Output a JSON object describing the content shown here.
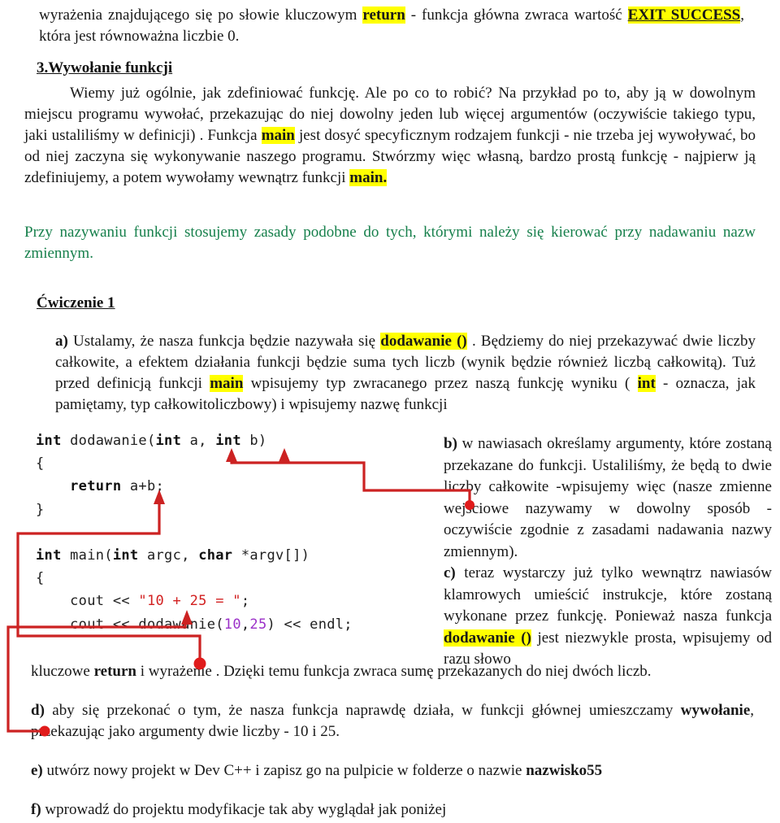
{
  "document": {
    "language": "pl",
    "colors": {
      "highlight": "#ffff00",
      "green_text": "#17804c",
      "annotation_red": "#cc2222",
      "code_string": "#d22020",
      "code_number": "#9b30c8"
    }
  },
  "top_paragraph": {
    "line1_pre": "wyrażenia znajdującego się po słowie kluczowym ",
    "line1_kw": "return",
    "line1_post": " - funkcja główna zwraca wartość ",
    "line2_kw": "EXIT SUCCESS",
    "line2_post": ", która jest równoważna liczbie 0."
  },
  "section_heading": "3.Wywołanie funkcji",
  "section_paragraph": {
    "part1": "Wiemy już ogólnie, jak zdefiniować funkcję. Ale po co to robić? Na przykład po to, aby ją w dowolnym miejscu programu wywołać, przekazując do niej dowolny jeden lub więcej argumentów (oczywiście takiego typu, jaki ustaliliśmy w definicji) . Funkcja ",
    "kw1": "main",
    "part2": " jest dosyć specyficznym rodzajem funkcji - nie trzeba jej wywoływać, bo od niej zaczyna się wykonywanie naszego programu. Stwórzmy więc własną, bardzo prostą funkcję - najpierw ją zdefiniujemy, a potem wywołamy wewnątrz funkcji ",
    "kw2": "main."
  },
  "green_note": "Przy nazywaniu funkcji stosujemy zasady podobne do tych, którymi należy się kierować przy nadawaniu nazw zmiennym.",
  "exercise_heading": "Ćwiczenie 1",
  "item_a": {
    "label": "a)",
    "part1": " Ustalamy, że nasza funkcja będzie nazywała się ",
    "kw1": "dodawanie ()",
    "part2": " . Będziemy do niej przekazywać dwie liczby całkowite, a efektem działania funkcji będzie suma tych liczb (wynik będzie również liczbą całkowitą). Tuż przed definicją funkcji ",
    "kw2": "main",
    "part3": " wpisujemy typ zwracanego przez naszą funkcję wyniku ( ",
    "kw3": "int",
    "part4": " - oznacza, jak pamiętamy, typ całkowitoliczbowy) i wpisujemy nazwę funkcji"
  },
  "code_block": {
    "lines": [
      {
        "segments": [
          {
            "t": "int",
            "s": "kw"
          },
          {
            "t": " dodawanie(",
            "s": ""
          },
          {
            "t": "int",
            "s": "kw"
          },
          {
            "t": " a, ",
            "s": ""
          },
          {
            "t": "int",
            "s": "kw"
          },
          {
            "t": " b)",
            "s": ""
          }
        ]
      },
      {
        "segments": [
          {
            "t": "{",
            "s": ""
          }
        ]
      },
      {
        "segments": [
          {
            "t": "    ",
            "s": ""
          },
          {
            "t": "return",
            "s": "kw"
          },
          {
            "t": " a+b;",
            "s": ""
          }
        ]
      },
      {
        "segments": [
          {
            "t": "}",
            "s": ""
          }
        ]
      },
      {
        "segments": [
          {
            "t": "",
            "s": ""
          }
        ]
      },
      {
        "segments": [
          {
            "t": "int",
            "s": "kw"
          },
          {
            "t": " main(",
            "s": ""
          },
          {
            "t": "int",
            "s": "kw"
          },
          {
            "t": " argc, ",
            "s": ""
          },
          {
            "t": "char",
            "s": "kw"
          },
          {
            "t": " *argv[])",
            "s": ""
          }
        ]
      },
      {
        "segments": [
          {
            "t": "{",
            "s": ""
          }
        ]
      },
      {
        "segments": [
          {
            "t": "    cout << ",
            "s": ""
          },
          {
            "t": "\"10 + 25 = \"",
            "s": "str"
          },
          {
            "t": ";",
            "s": ""
          }
        ]
      },
      {
        "segments": [
          {
            "t": "    cout << dodawanie(",
            "s": ""
          },
          {
            "t": "10",
            "s": "num"
          },
          {
            "t": ",",
            "s": ""
          },
          {
            "t": "25",
            "s": "num"
          },
          {
            "t": ") << endl;",
            "s": ""
          }
        ]
      }
    ]
  },
  "right_column": {
    "item_b_label": "b)",
    "item_b_text": " w nawiasach określamy argumenty, które zostaną przekazane do funkcji. Ustaliliśmy, że będą to dwie liczby całkowite -wpisujemy więc (nasze zmienne wejściowe nazywamy w dowolny sposób - oczywiście zgodnie z zasadami nadawania nazwy zmiennym).",
    "item_c_label": "c)",
    "item_c_part1": " teraz wystarczy już tylko wewnątrz nawiasów klamrowych umieścić instrukcje, które zostaną wykonane przez funkcję. Ponieważ nasza funkcja ",
    "item_c_kw": "dodawanie ()",
    "item_c_part2": " jest niezwykle prosta, wpisujemy od razu słowo"
  },
  "caption_line": {
    "part1": "kluczowe ",
    "kw": "return",
    "part2": " i wyrażenie . Dzięki temu funkcja zwraca sumę przekazanych do niej dwóch liczb."
  },
  "item_d": {
    "label": "d)",
    "part1": " aby się przekonać o tym, że nasza funkcja naprawdę działa, w funkcji głównej umieszczamy ",
    "kw": "wywołanie",
    "part2": ", przekazując jako argumenty dwie liczby - 10 i 25."
  },
  "item_e": {
    "label": "e)",
    "part1": " utwórz nowy projekt w Dev C++ i zapisz go na pulpicie w folderze o nazwie ",
    "kw": "nazwisko55"
  },
  "item_f": {
    "label": "f)",
    "part1": " wprowadź do projektu modyfikacje tak aby wyglądał jak poniżej"
  }
}
